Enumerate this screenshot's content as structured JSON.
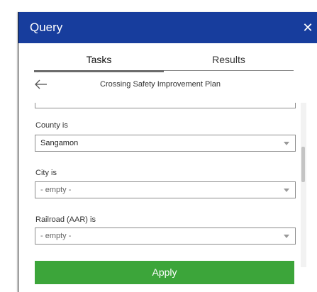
{
  "header": {
    "title": "Query",
    "close_glyph": "✕"
  },
  "tabs": [
    {
      "label": "Tasks",
      "active": true
    },
    {
      "label": "Results",
      "active": false
    }
  ],
  "task": {
    "title": "Crossing Safety Improvement Plan",
    "back_icon": "arrow-left-icon"
  },
  "fields": [
    {
      "label": "County is",
      "value": "Sangamon",
      "empty": false
    },
    {
      "label": "City is",
      "value": "- empty -",
      "empty": true
    },
    {
      "label": "Railroad (AAR) is",
      "value": "- empty -",
      "empty": true
    }
  ],
  "actions": {
    "apply_label": "Apply"
  },
  "colors": {
    "header_bg": "#173d9d",
    "apply_bg": "#3ca53a"
  }
}
